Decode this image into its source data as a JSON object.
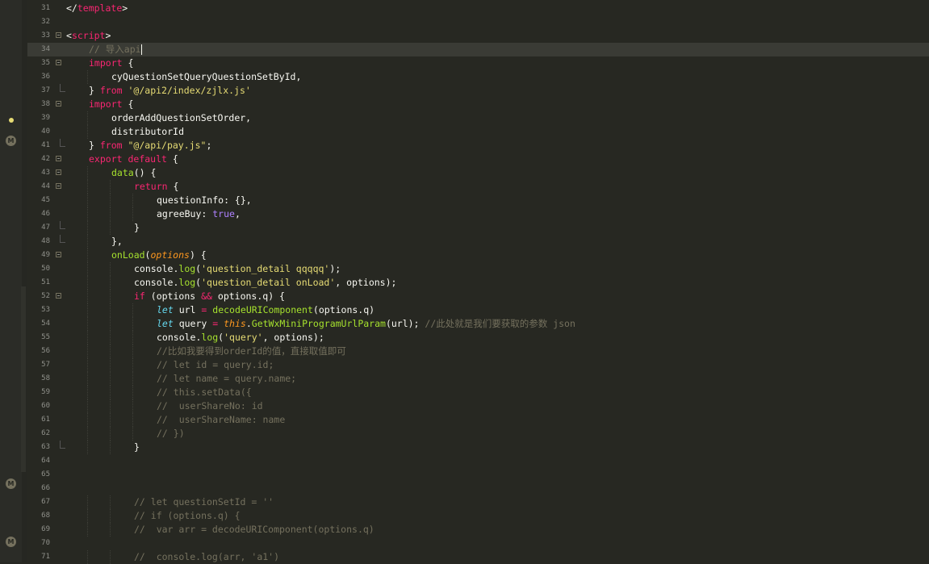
{
  "editor": {
    "lines": [
      {
        "n": "31",
        "tokens": [
          {
            "t": "</",
            "c": ""
          },
          {
            "t": "template",
            "c": "tag"
          },
          {
            "t": ">",
            "c": ""
          }
        ],
        "indent": 0
      },
      {
        "n": "32",
        "tokens": [],
        "indent": 0
      },
      {
        "n": "33",
        "tokens": [
          {
            "t": "<",
            "c": ""
          },
          {
            "t": "script",
            "c": "tag"
          },
          {
            "t": ">",
            "c": ""
          }
        ],
        "indent": 0,
        "fold": true
      },
      {
        "n": "34",
        "tokens": [
          {
            "t": "// 导入api",
            "c": "cm"
          }
        ],
        "indent": 1,
        "current": true,
        "caret": true
      },
      {
        "n": "35",
        "tokens": [
          {
            "t": "import",
            "c": "kw"
          },
          {
            "t": " {",
            "c": ""
          }
        ],
        "indent": 1,
        "fold": true
      },
      {
        "n": "36",
        "tokens": [
          {
            "t": "cyQuestionSetQueryQuestionSetById,",
            "c": ""
          }
        ],
        "indent": 2
      },
      {
        "n": "37",
        "tokens": [
          {
            "t": "} ",
            "c": ""
          },
          {
            "t": "from",
            "c": "kw"
          },
          {
            "t": " ",
            "c": ""
          },
          {
            "t": "'@/api2/index/zjlx.js'",
            "c": "str"
          }
        ],
        "indent": 1,
        "foldEnd": true
      },
      {
        "n": "38",
        "tokens": [
          {
            "t": "import",
            "c": "kw"
          },
          {
            "t": " {",
            "c": ""
          }
        ],
        "indent": 1,
        "fold": true
      },
      {
        "n": "39",
        "tokens": [
          {
            "t": "orderAddQuestionSetOrder,",
            "c": ""
          }
        ],
        "indent": 2
      },
      {
        "n": "40",
        "tokens": [
          {
            "t": "distributorId",
            "c": ""
          }
        ],
        "indent": 2
      },
      {
        "n": "41",
        "tokens": [
          {
            "t": "} ",
            "c": ""
          },
          {
            "t": "from",
            "c": "kw"
          },
          {
            "t": " ",
            "c": ""
          },
          {
            "t": "\"@/api/pay.js\"",
            "c": "str"
          },
          {
            "t": ";",
            "c": ""
          }
        ],
        "indent": 1,
        "foldEnd": true
      },
      {
        "n": "42",
        "tokens": [
          {
            "t": "export",
            "c": "kw"
          },
          {
            "t": " ",
            "c": ""
          },
          {
            "t": "default",
            "c": "kw"
          },
          {
            "t": " {",
            "c": ""
          }
        ],
        "indent": 1,
        "fold": true
      },
      {
        "n": "43",
        "tokens": [
          {
            "t": "data",
            "c": "fn"
          },
          {
            "t": "() {",
            "c": ""
          }
        ],
        "indent": 2,
        "fold": true
      },
      {
        "n": "44",
        "tokens": [
          {
            "t": "return",
            "c": "kw"
          },
          {
            "t": " {",
            "c": ""
          }
        ],
        "indent": 3,
        "fold": true
      },
      {
        "n": "45",
        "tokens": [
          {
            "t": "questionInfo: {},",
            "c": ""
          }
        ],
        "indent": 4
      },
      {
        "n": "46",
        "tokens": [
          {
            "t": "agreeBuy: ",
            "c": ""
          },
          {
            "t": "true",
            "c": "num"
          },
          {
            "t": ",",
            "c": ""
          }
        ],
        "indent": 4
      },
      {
        "n": "47",
        "tokens": [
          {
            "t": "}",
            "c": ""
          }
        ],
        "indent": 3,
        "foldEnd": true
      },
      {
        "n": "48",
        "tokens": [
          {
            "t": "},",
            "c": ""
          }
        ],
        "indent": 2,
        "foldEnd": true
      },
      {
        "n": "49",
        "tokens": [
          {
            "t": "onLoad",
            "c": "fn"
          },
          {
            "t": "(",
            "c": ""
          },
          {
            "t": "options",
            "c": "param"
          },
          {
            "t": ") {",
            "c": ""
          }
        ],
        "indent": 2,
        "fold": true
      },
      {
        "n": "50",
        "tokens": [
          {
            "t": "console.",
            "c": ""
          },
          {
            "t": "log",
            "c": "fn"
          },
          {
            "t": "(",
            "c": ""
          },
          {
            "t": "'question_detail qqqqq'",
            "c": "str"
          },
          {
            "t": ");",
            "c": ""
          }
        ],
        "indent": 3
      },
      {
        "n": "51",
        "tokens": [
          {
            "t": "console.",
            "c": ""
          },
          {
            "t": "log",
            "c": "fn"
          },
          {
            "t": "(",
            "c": ""
          },
          {
            "t": "'question_detail onLoad'",
            "c": "str"
          },
          {
            "t": ", options);",
            "c": ""
          }
        ],
        "indent": 3
      },
      {
        "n": "52",
        "tokens": [
          {
            "t": "if",
            "c": "kw"
          },
          {
            "t": " (options ",
            "c": ""
          },
          {
            "t": "&&",
            "c": "kw"
          },
          {
            "t": " options.q) {",
            "c": ""
          }
        ],
        "indent": 3,
        "fold": true
      },
      {
        "n": "53",
        "tokens": [
          {
            "t": "let",
            "c": "it"
          },
          {
            "t": " url ",
            "c": ""
          },
          {
            "t": "=",
            "c": "kw"
          },
          {
            "t": " ",
            "c": ""
          },
          {
            "t": "decodeURIComponent",
            "c": "fn"
          },
          {
            "t": "(options.q)",
            "c": ""
          }
        ],
        "indent": 4
      },
      {
        "n": "54",
        "tokens": [
          {
            "t": "let",
            "c": "it"
          },
          {
            "t": " query ",
            "c": ""
          },
          {
            "t": "=",
            "c": "kw"
          },
          {
            "t": " ",
            "c": ""
          },
          {
            "t": "this",
            "c": "param"
          },
          {
            "t": ".",
            "c": ""
          },
          {
            "t": "GetWxMiniProgramUrlParam",
            "c": "fn"
          },
          {
            "t": "(url); ",
            "c": ""
          },
          {
            "t": "//此处就是我们要获取的参数 json",
            "c": "cm"
          }
        ],
        "indent": 4
      },
      {
        "n": "55",
        "tokens": [
          {
            "t": "console.",
            "c": ""
          },
          {
            "t": "log",
            "c": "fn"
          },
          {
            "t": "(",
            "c": ""
          },
          {
            "t": "'query'",
            "c": "str"
          },
          {
            "t": ", options);",
            "c": ""
          }
        ],
        "indent": 4
      },
      {
        "n": "56",
        "tokens": [
          {
            "t": "//比如我要得到orderId的值，直接取值即可",
            "c": "cm"
          }
        ],
        "indent": 4
      },
      {
        "n": "57",
        "tokens": [
          {
            "t": "// let id = query.id;",
            "c": "cm"
          }
        ],
        "indent": 4
      },
      {
        "n": "58",
        "tokens": [
          {
            "t": "// let name = query.name;",
            "c": "cm"
          }
        ],
        "indent": 4
      },
      {
        "n": "59",
        "tokens": [
          {
            "t": "// this.setData({",
            "c": "cm"
          }
        ],
        "indent": 4
      },
      {
        "n": "60",
        "tokens": [
          {
            "t": "//  userShareNo: id",
            "c": "cm"
          }
        ],
        "indent": 4
      },
      {
        "n": "61",
        "tokens": [
          {
            "t": "//  userShareName: name",
            "c": "cm"
          }
        ],
        "indent": 4
      },
      {
        "n": "62",
        "tokens": [
          {
            "t": "// })",
            "c": "cm"
          }
        ],
        "indent": 4
      },
      {
        "n": "63",
        "tokens": [
          {
            "t": "}",
            "c": ""
          }
        ],
        "indent": 3,
        "foldEnd": true
      },
      {
        "n": "64",
        "tokens": [],
        "indent": 0
      },
      {
        "n": "65",
        "tokens": [],
        "indent": 0
      },
      {
        "n": "66",
        "tokens": [],
        "indent": 0
      },
      {
        "n": "67",
        "tokens": [
          {
            "t": "// let questionSetId = ''",
            "c": "cm"
          }
        ],
        "indent": 3
      },
      {
        "n": "68",
        "tokens": [
          {
            "t": "// if (options.q) {",
            "c": "cm"
          }
        ],
        "indent": 3
      },
      {
        "n": "69",
        "tokens": [
          {
            "t": "//  var arr = decodeURIComponent(options.q)",
            "c": "cm"
          }
        ],
        "indent": 3
      },
      {
        "n": "70",
        "tokens": [],
        "indent": 0
      },
      {
        "n": "71",
        "tokens": [
          {
            "t": "//  console.log(arr, 'a1')",
            "c": "cm"
          }
        ],
        "indent": 3
      }
    ]
  },
  "sidebar": {
    "badges": [
      "M",
      "M",
      "M"
    ]
  }
}
